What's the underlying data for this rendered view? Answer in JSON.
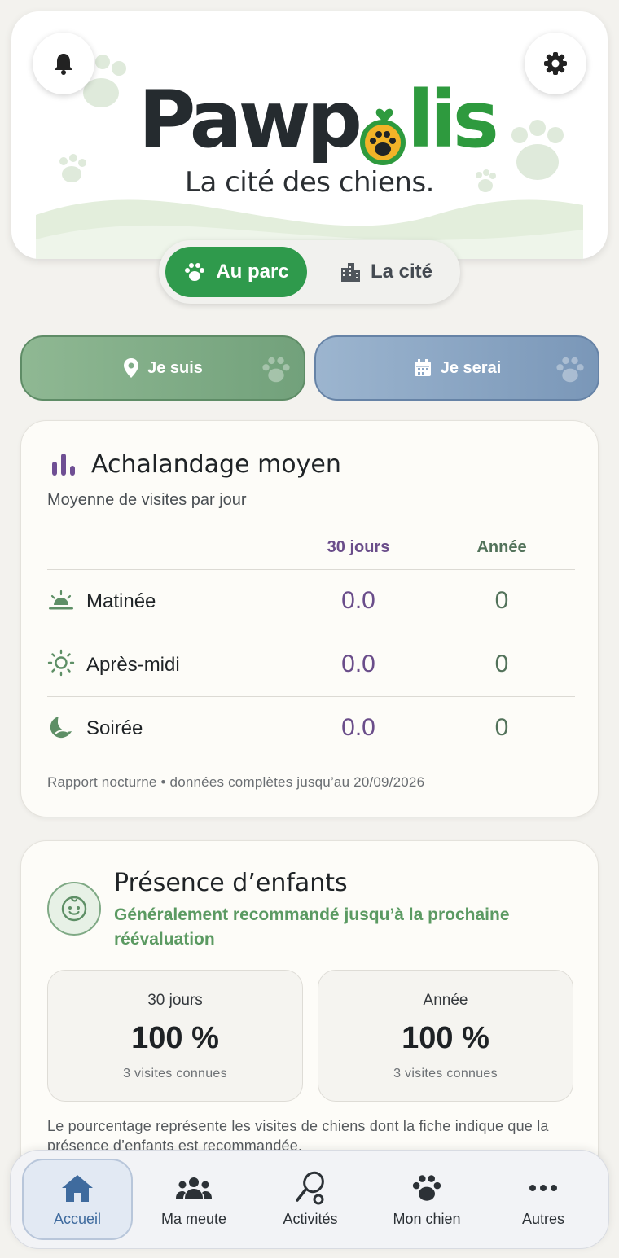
{
  "header": {
    "logo_text_left": "Pawp",
    "logo_text_right": "lis",
    "tagline": "La cité des chiens.",
    "notification_icon": "bell-icon",
    "settings_icon": "gear-icon"
  },
  "segment": {
    "active_label": "Au parc",
    "active_icon": "paw-icon",
    "inactive_label": "La cité",
    "inactive_icon": "city-icon"
  },
  "actions": {
    "je_suis_label": "Je suis",
    "je_suis_icon": "location-pin-icon",
    "je_serai_label": "Je serai",
    "je_serai_icon": "calendar-icon"
  },
  "traffic": {
    "title": "Achalandage moyen",
    "subtitle": "Moyenne de visites par jour",
    "col_30": "30 jours",
    "col_year": "Année",
    "rows": [
      {
        "label": "Matinée",
        "icon": "sunrise-icon",
        "v30": "0.0",
        "vyear": "0"
      },
      {
        "label": "Après-midi",
        "icon": "sun-icon",
        "v30": "0.0",
        "vyear": "0"
      },
      {
        "label": "Soirée",
        "icon": "moon-icon",
        "v30": "0.0",
        "vyear": "0"
      }
    ],
    "footnote": "Rapport nocturne • données complètes jusqu’au 20/09/2026"
  },
  "children": {
    "title": "Présence d’enfants",
    "recommendation": "Généralement recommandé jusqu’à la prochaine réévaluation",
    "box_30": {
      "label": "30 jours",
      "value": "100 %",
      "note": "3 visites connues"
    },
    "box_year": {
      "label": "Année",
      "value": "100 %",
      "note": "3 visites connues"
    },
    "footnote": "Le pourcentage représente les visites de chiens dont la fiche indique que la présence d’enfants est recommandée."
  },
  "nav": {
    "items": [
      {
        "label": "Accueil",
        "icon": "home-icon"
      },
      {
        "label": "Ma meute",
        "icon": "group-icon"
      },
      {
        "label": "Activités",
        "icon": "ball-racket-icon"
      },
      {
        "label": "Mon chien",
        "icon": "paw-icon"
      },
      {
        "label": "Autres",
        "icon": "more-icon"
      }
    ]
  },
  "colors": {
    "brand_green": "#2f9a4c",
    "purple_accent": "#6a4d8a",
    "year_green": "#52725a",
    "nav_active": "#3f6b9e"
  }
}
